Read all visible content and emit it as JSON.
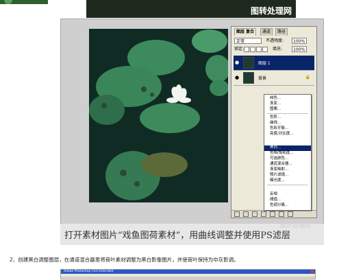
{
  "top": {
    "banner_text": "图转处理网"
  },
  "photoshop": {
    "tabs": [
      "图层 复合",
      "通道",
      "路径"
    ],
    "active_tab": 0,
    "blend_mode": "正常",
    "opacity_label": "不透明度:",
    "opacity_value": "100%",
    "lock_label": "锁定:",
    "fill_label": "填充:",
    "fill_value": "100%",
    "layers": [
      {
        "name": "图层 1",
        "selected": true,
        "visible": true
      },
      {
        "name": "背景",
        "selected": false,
        "visible": true,
        "locked": true
      }
    ],
    "menu_items": [
      {
        "label": "纯色...",
        "highlighted": false
      },
      {
        "label": "渐变...",
        "highlighted": false
      },
      {
        "label": "图案...",
        "highlighted": false
      },
      {
        "label": "色阶...",
        "highlighted": false
      },
      {
        "label": "曲线...",
        "highlighted": false
      },
      {
        "label": "色彩平衡...",
        "highlighted": false
      },
      {
        "label": "亮度/对比度...",
        "highlighted": false
      },
      {
        "label": "黑白...",
        "highlighted": true
      },
      {
        "label": "色相/饱和度...",
        "highlighted": false
      },
      {
        "label": "可选颜色...",
        "highlighted": false
      },
      {
        "label": "通道混合器...",
        "highlighted": false
      },
      {
        "label": "渐变映射...",
        "highlighted": false
      },
      {
        "label": "照片滤镜...",
        "highlighted": false
      },
      {
        "label": "曝光度...",
        "highlighted": false
      },
      {
        "label": "反相",
        "highlighted": false
      },
      {
        "label": "阈值...",
        "highlighted": false
      },
      {
        "label": "色调分离...",
        "highlighted": false
      }
    ],
    "colors": {
      "selection": "#0a246a",
      "panel": "#ece9d8"
    }
  },
  "caption": {
    "text": "打开素材图片“戏鱼图荷素材”，用曲线调整并使用PS滤层",
    "watermark": "照片处理网"
  },
  "step": {
    "text": "2、创建黑白调整图层，在通道混合器里将荷叶素材调整为黑白影像图片，并使荷叶保持为中灰影调。"
  },
  "next_screenshot": {
    "title": "Adobe Photoshop CS3 Extended"
  }
}
